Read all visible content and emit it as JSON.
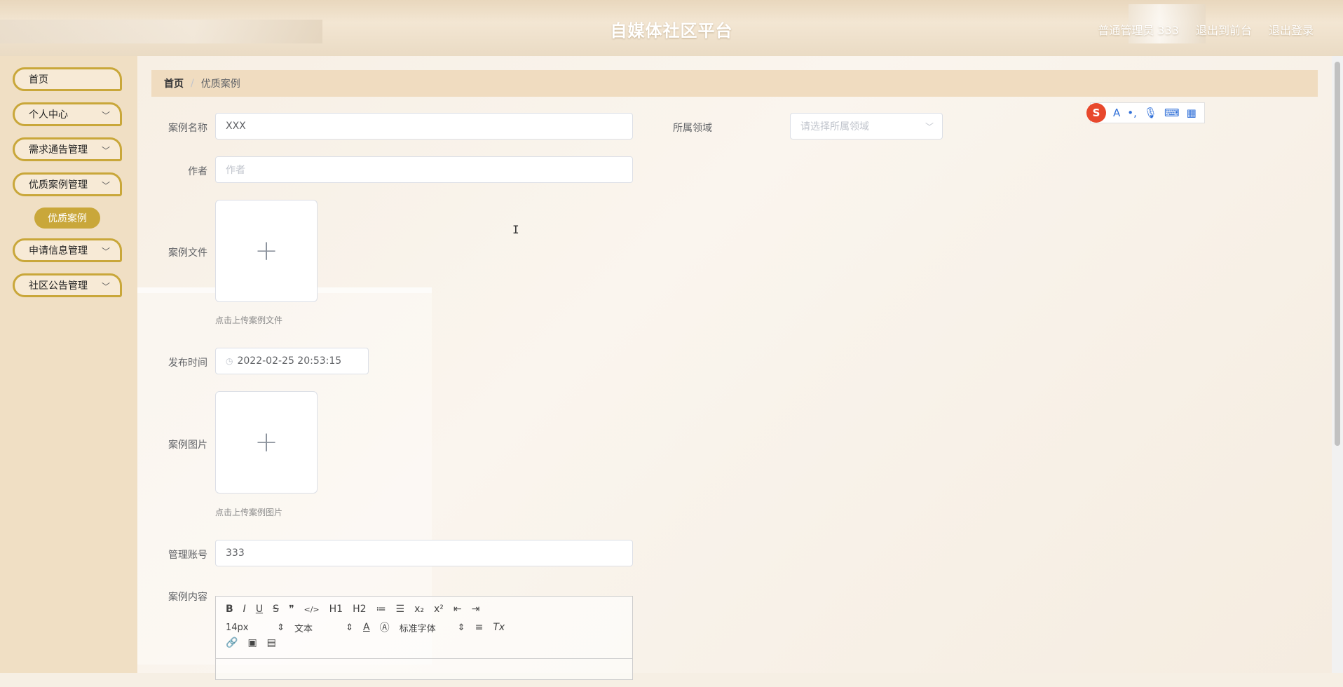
{
  "header": {
    "title": "自媒体社区平台",
    "user": "普通管理员 333",
    "front": "退出到前台",
    "logout": "退出登录"
  },
  "sidebar": {
    "items": [
      {
        "label": "首页"
      },
      {
        "label": "个人中心"
      },
      {
        "label": "需求通告管理"
      },
      {
        "label": "优质案例管理"
      },
      {
        "label": "申请信息管理"
      },
      {
        "label": "社区公告管理"
      }
    ],
    "sub_item": "优质案例"
  },
  "breadcrumb": {
    "home": "首页",
    "separator": "/",
    "current": "优质案例"
  },
  "form": {
    "case_name": {
      "label": "案例名称",
      "value": "XXX"
    },
    "domain": {
      "label": "所属领域",
      "placeholder": "请选择所属领域"
    },
    "author": {
      "label": "作者",
      "placeholder": "作者"
    },
    "case_file": {
      "label": "案例文件",
      "tip": "点击上传案例文件"
    },
    "publish_time": {
      "label": "发布时间",
      "value": "2022-02-25 20:53:15"
    },
    "case_image": {
      "label": "案例图片",
      "tip": "点击上传案例图片"
    },
    "account": {
      "label": "管理账号",
      "value": "333"
    },
    "content": {
      "label": "案例内容"
    }
  },
  "editor": {
    "row1": [
      "B",
      "I",
      "U",
      "S",
      "❞",
      "</>",
      "H1",
      "H2",
      "≔",
      "☰",
      "x₂",
      "x²",
      "⇤",
      "⇥"
    ],
    "font_size": "14px",
    "block_type": "文本",
    "font_family": "标准字体",
    "clear": "Tx"
  },
  "icons": {
    "upload": "plus-icon",
    "time": "clock-icon",
    "select": "chevron-down-icon"
  }
}
